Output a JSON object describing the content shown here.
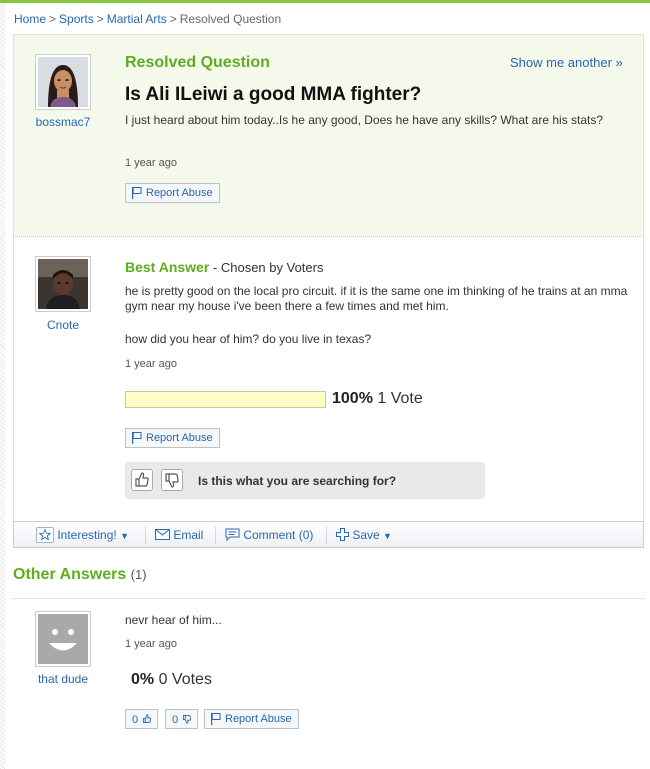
{
  "breadcrumb": [
    "Home",
    "Sports",
    "Martial Arts",
    "Resolved Question"
  ],
  "question": {
    "status": "Resolved Question",
    "show_another": "Show me another »",
    "title": "Is Ali ILeiwi a good MMA fighter?",
    "body": "I just heard about him today..Is he any good, Does he have any skills? What are his stats?",
    "time": "1 year ago",
    "asker": "bossmac7",
    "report": "Report Abuse"
  },
  "best_answer": {
    "heading": "Best Answer",
    "chosen_by": " - Chosen by Voters",
    "answerer": "Cnote",
    "body1": "he is pretty good on the local pro circuit. if it is the same one im thinking of he trains at an mma gym near my house i've been there a few times and met him.",
    "body2": "how did you hear of him? do you live in texas?",
    "time": "1 year ago",
    "vote_percent": "100%",
    "vote_count": "1 Vote",
    "vote_fraction": 1.0,
    "report": "Report Abuse",
    "feedback_question": "Is this what you are searching for?"
  },
  "actions": {
    "interesting": "Interesting!",
    "email": "Email",
    "comment": "Comment (0)",
    "save": "Save"
  },
  "other_answers": {
    "title": "Other Answers",
    "count": "(1)",
    "items": [
      {
        "user": "that dude",
        "body": "nevr hear of him...",
        "time": "1 year ago",
        "vote_percent": "0%",
        "vote_count": "0 Votes",
        "thumbs_up": "0",
        "thumbs_down": "0",
        "report": "Report Abuse"
      }
    ]
  },
  "colors": {
    "accent_green": "#5fad1e",
    "link_blue": "#2668b4",
    "vote_bar": "#ffffc6"
  }
}
